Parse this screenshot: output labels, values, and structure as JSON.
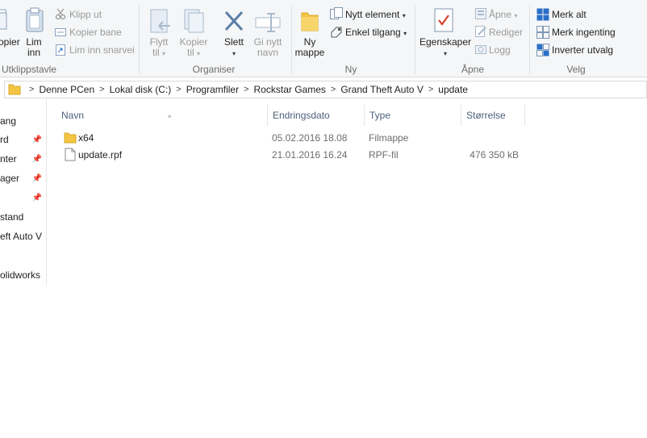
{
  "ribbon": {
    "clipboard": {
      "copy_partial": "opier",
      "paste_label_1": "Lim",
      "paste_label_2": "inn",
      "cut": "Klipp ut",
      "copy_path": "Kopier bane",
      "paste_shortcut": "Lim inn snarvei",
      "group_label": "Utklippstavle"
    },
    "organize": {
      "move_1": "Flytt",
      "move_2": "til",
      "copy_1": "Kopier",
      "copy_2": "til",
      "delete": "Slett",
      "rename_1": "Gi nytt",
      "rename_2": "navn",
      "group_label": "Organiser"
    },
    "new": {
      "new_folder_1": "Ny",
      "new_folder_2": "mappe",
      "new_item": "Nytt element",
      "easy_access": "Enkel tilgang",
      "group_label": "Ny"
    },
    "open": {
      "properties": "Egenskaper",
      "open": "Åpne",
      "edit": "Rediger",
      "history": "Logg",
      "group_label": "Åpne"
    },
    "select": {
      "select_all": "Merk alt",
      "select_none": "Merk ingenting",
      "invert": "Inverter utvalg",
      "group_label": "Velg"
    }
  },
  "address": {
    "crumbs": [
      "Denne PCen",
      "Lokal disk (C:)",
      "Programfiler",
      "Rockstar Games",
      "Grand Theft Auto V",
      "update"
    ]
  },
  "nav": {
    "items": [
      {
        "label": "ang",
        "pinned": false
      },
      {
        "label": "rd",
        "pinned": true
      },
      {
        "label": "nter",
        "pinned": true
      },
      {
        "label": "ager",
        "pinned": true
      },
      {
        "label": "",
        "pinned": true
      },
      {
        "label": "stand",
        "pinned": false
      },
      {
        "label": "eft Auto V",
        "pinned": false
      },
      {
        "label": "",
        "pinned": false
      },
      {
        "label": "olidworks",
        "pinned": false
      }
    ]
  },
  "files": {
    "columns": {
      "name": "Navn",
      "date": "Endringsdato",
      "type": "Type",
      "size": "Størrelse"
    },
    "rows": [
      {
        "name": "x64",
        "date": "05.02.2016 18.08",
        "type": "Filmappe",
        "size": "",
        "kind": "folder"
      },
      {
        "name": "update.rpf",
        "date": "21.01.2016 16.24",
        "type": "RPF-fil",
        "size": "476 350 kB",
        "kind": "file"
      }
    ]
  },
  "colors": {
    "folder_yellow": "#f4c542",
    "accent_blue": "#2b6fc7",
    "delete_blue": "#5a7fa6",
    "header_text": "#4c607a"
  }
}
